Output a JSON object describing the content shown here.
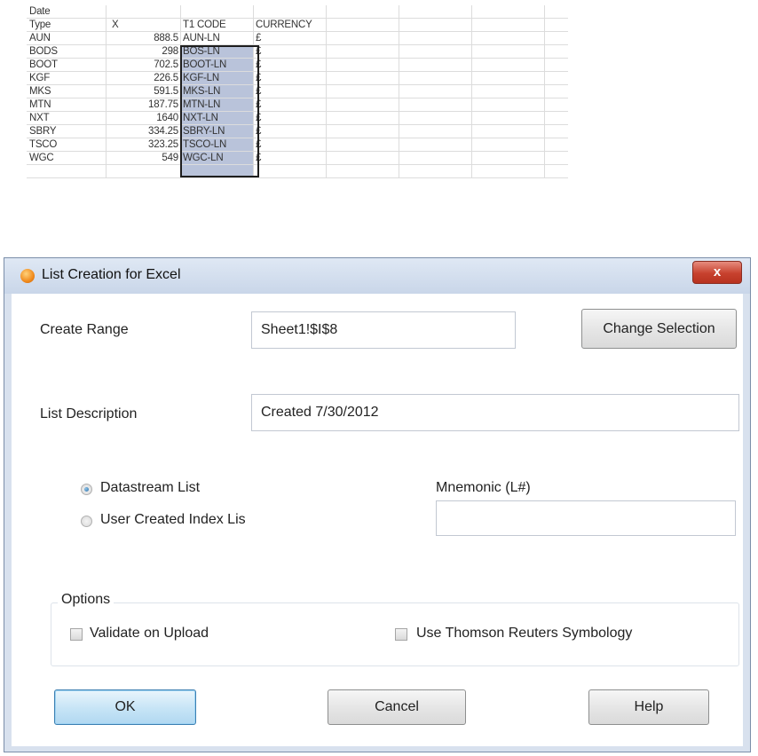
{
  "sheet": {
    "header_rows": [
      [
        "Date",
        "",
        "",
        ""
      ],
      [
        "Type",
        "X",
        "T1 CODE",
        "CURRENCY"
      ]
    ],
    "rows": [
      [
        "AUN",
        "888.5",
        "AUN-LN",
        "£"
      ],
      [
        "BODS",
        "298",
        "BOS-LN",
        "£"
      ],
      [
        "BOOT",
        "702.5",
        "BOOT-LN",
        "£"
      ],
      [
        "KGF",
        "226.5",
        "KGF-LN",
        "£"
      ],
      [
        "MKS",
        "591.5",
        "MKS-LN",
        "£"
      ],
      [
        "MTN",
        "187.75",
        "MTN-LN",
        "£"
      ],
      [
        "NXT",
        "1640",
        "NXT-LN",
        "£"
      ],
      [
        "SBRY",
        "334.25",
        "SBRY-LN",
        "£"
      ],
      [
        "TSCO",
        "323.25",
        "TSCO-LN",
        "£"
      ],
      [
        "WGC",
        "549",
        "WGC-LN",
        "£"
      ]
    ]
  },
  "dialog": {
    "title": "List Creation for Excel",
    "close_label": "x",
    "create_range": {
      "label": "Create Range",
      "value": "Sheet1!$I$8",
      "change_button": "Change Selection"
    },
    "list_description": {
      "label": "List Description",
      "value": "Created 7/30/2012"
    },
    "list_type": {
      "options": [
        "Datastream List",
        "User Created Index Lis"
      ],
      "selected": "Datastream List"
    },
    "mnemonic": {
      "label": "Mnemonic (L#)",
      "value": ""
    },
    "options": {
      "caption": "Options",
      "validate_label": "Validate on Upload",
      "symbology_label": "Use Thomson Reuters Symbology"
    },
    "buttons": {
      "ok": "OK",
      "cancel": "Cancel",
      "help": "Help"
    }
  },
  "colors": {
    "selection": "#b9c3da",
    "titlebar": "#d0dcec",
    "close_button": "#c7412e"
  }
}
